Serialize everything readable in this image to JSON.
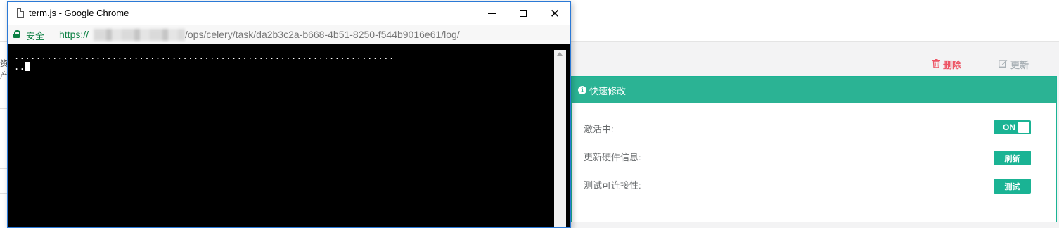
{
  "background": {
    "left_glyph": "资产",
    "actions": {
      "delete_label": "删除",
      "update_label": "更新"
    },
    "panel": {
      "title": "快速修改",
      "rows": [
        {
          "label": "激活中:",
          "control": "ON"
        },
        {
          "label": "更新硬件信息:",
          "control": "刷新"
        },
        {
          "label": "测试可连接性:",
          "control": "测试"
        }
      ]
    }
  },
  "window": {
    "title": "term.js - Google Chrome",
    "address": {
      "secure_label": "安全",
      "scheme": "https://",
      "path": "/ops/celery/task/da2b3c2a-b668-4b51-8250-f544b9016e61/log/"
    },
    "terminal": {
      "line1": "......................................................................",
      "line2": ".."
    }
  },
  "colors": {
    "accent": "#1ab394",
    "danger": "#ed5565",
    "muted": "#a9b1b6",
    "secure": "#0b8043"
  }
}
